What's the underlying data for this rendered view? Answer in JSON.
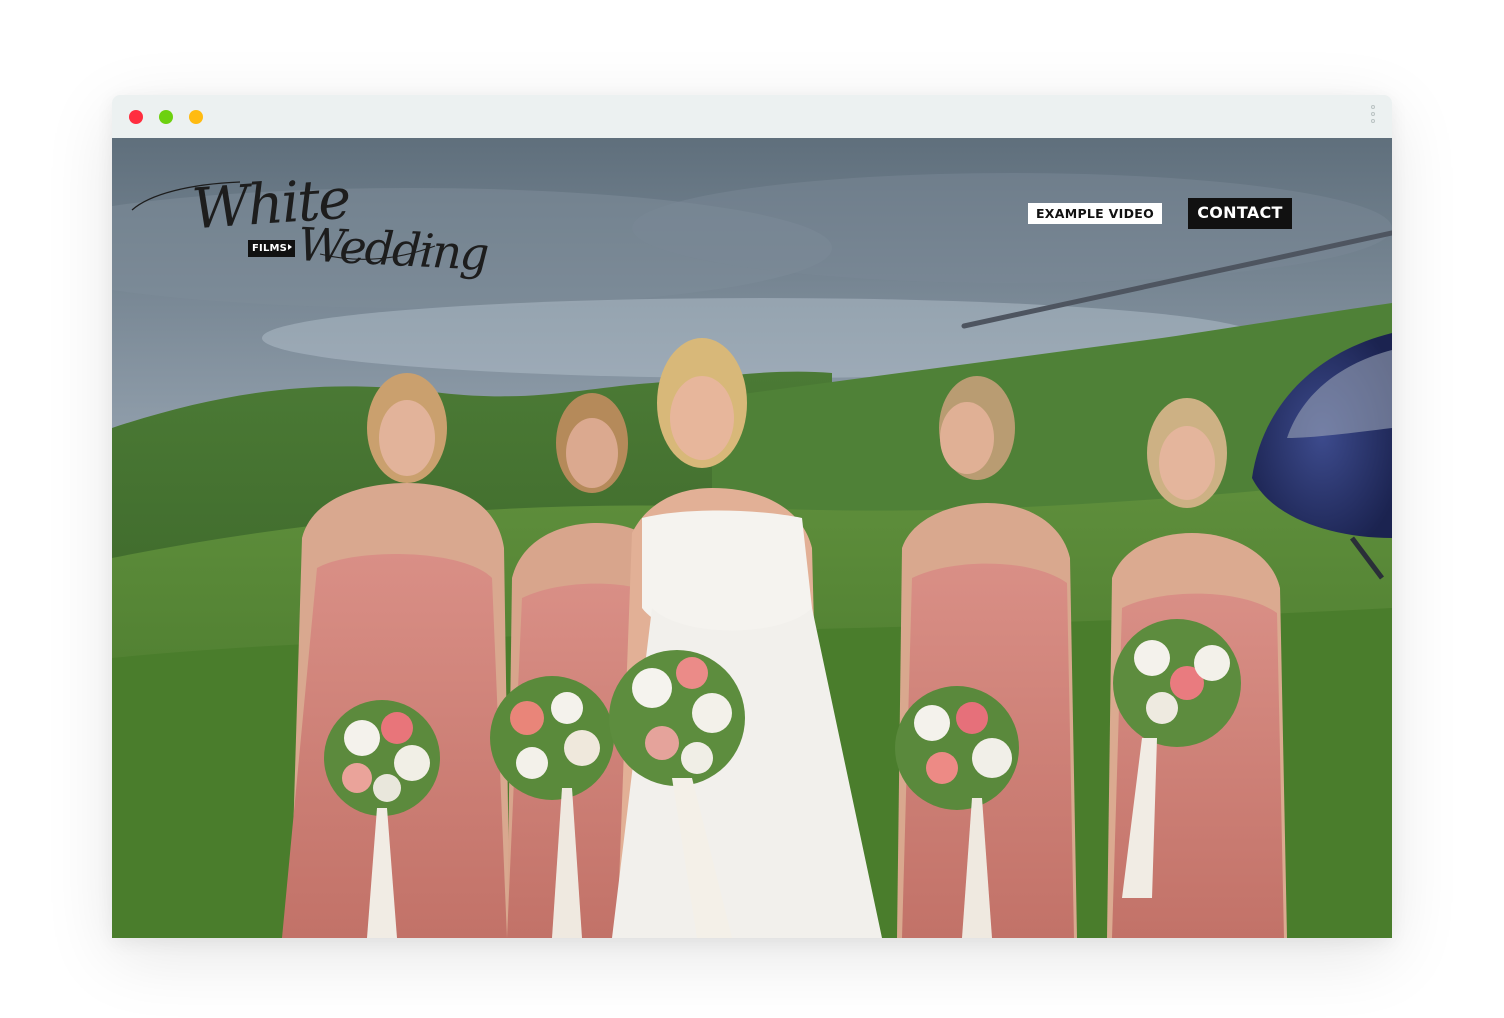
{
  "browser": {
    "window_controls": [
      "close",
      "minimize",
      "maximize"
    ],
    "menu_icon": "kebab-menu-icon"
  },
  "site": {
    "logo": {
      "line1": "White",
      "line2": "Wedding",
      "badge": "FILMS"
    },
    "nav": {
      "example_video_label": "EXAMPLE VIDEO",
      "contact_label": "CONTACT"
    },
    "hero": {
      "image_alt": "Bride laughing with four bridesmaids in pink dresses holding bouquets on a green hillside, helicopter in the background"
    }
  },
  "colors": {
    "titlebar": "#ecf1f1",
    "close": "#ff2d3f",
    "minimize": "#6dd10f",
    "maximize": "#ffbb11",
    "contact_bg": "#111111",
    "example_bg": "#ffffff"
  }
}
